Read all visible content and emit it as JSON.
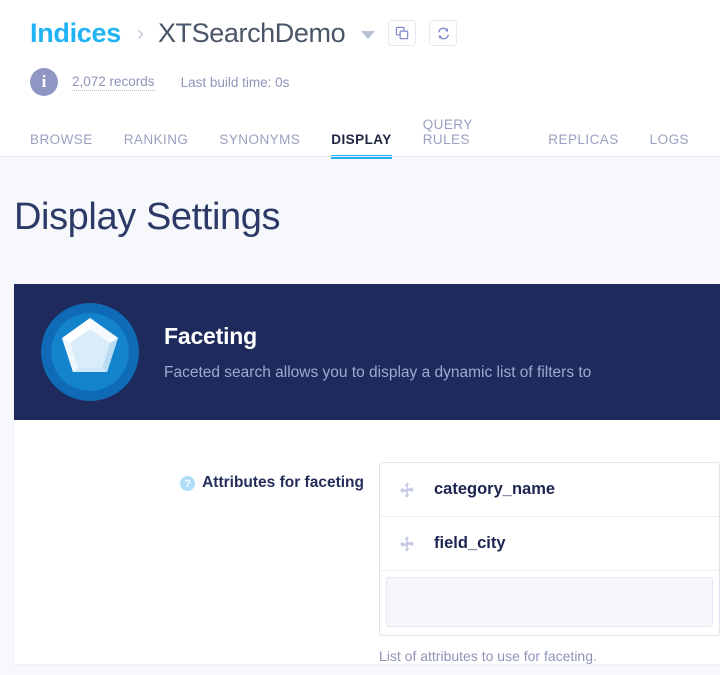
{
  "breadcrumb": {
    "root_label": "Indices",
    "separator": "›",
    "index_name": "XTSearchDemo",
    "dropdown_icon": "chevron-down-icon",
    "copy_icon": "copy-icon",
    "refresh_icon": "refresh-icon"
  },
  "info": {
    "icon": "info-icon",
    "records": "2,072 records",
    "build_time": "Last build time: 0s"
  },
  "tabs": [
    {
      "label": "BROWSE",
      "active": false
    },
    {
      "label": "RANKING",
      "active": false
    },
    {
      "label": "SYNONYMS",
      "active": false
    },
    {
      "label": "DISPLAY",
      "active": true
    },
    {
      "label": "QUERY RULES",
      "active": false
    },
    {
      "label": "REPLICAS",
      "active": false
    },
    {
      "label": "LOGS",
      "active": false
    }
  ],
  "page": {
    "title": "Display Settings"
  },
  "banner": {
    "logo_icon": "gem-logo-icon",
    "title": "Faceting",
    "description": "Faceted search allows you to display a dynamic list of filters to"
  },
  "faceting_form": {
    "help_icon": "help-icon",
    "label": "Attributes for faceting",
    "attributes": [
      {
        "name": "category_name",
        "drag_icon": "move-handle-icon"
      },
      {
        "name": "field_city",
        "drag_icon": "move-handle-icon"
      }
    ],
    "add_placeholder": "",
    "helper_text": "List of attributes to use for faceting."
  },
  "colors": {
    "accent_blue": "#21b3f3",
    "banner_navy": "#1e2a5c",
    "page_bg": "#f7f8fc",
    "title_navy": "#2d3a67",
    "muted": "#8e94b8"
  }
}
